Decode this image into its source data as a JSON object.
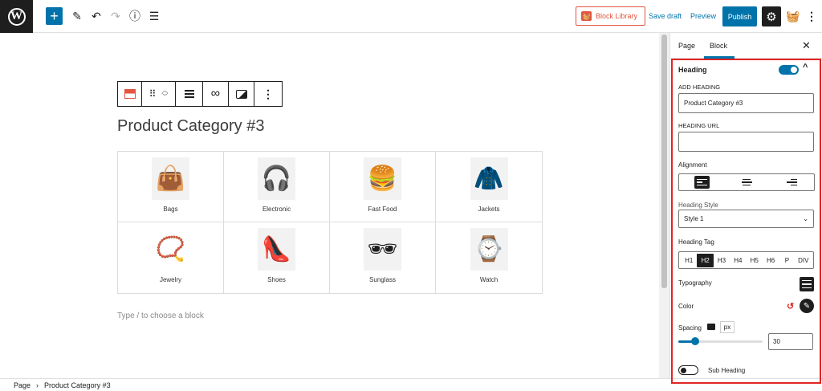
{
  "topbar": {
    "wp_logo": "W",
    "add_icon": "+",
    "block_library_label": "Block Library",
    "save_draft_label": "Save draft",
    "preview_label": "Preview",
    "publish_label": "Publish"
  },
  "editor": {
    "heading": "Product Category #3",
    "placeholder": "Type / to choose a block",
    "categories": [
      {
        "label": "Bags",
        "icon": "bag-icon",
        "glyph": "👜"
      },
      {
        "label": "Electronic",
        "icon": "headphones-icon",
        "glyph": "🎧"
      },
      {
        "label": "Fast Food",
        "icon": "burger-icon",
        "glyph": "🍔"
      },
      {
        "label": "Jackets",
        "icon": "jacket-icon",
        "glyph": "🧥"
      },
      {
        "label": "Jewelry",
        "icon": "necklace-icon",
        "glyph": "📿"
      },
      {
        "label": "Shoes",
        "icon": "high-heel-icon",
        "glyph": "👠"
      },
      {
        "label": "Sunglass",
        "icon": "sunglasses-icon",
        "glyph": "🕶"
      },
      {
        "label": "Watch",
        "icon": "watch-icon",
        "glyph": "⌚"
      }
    ]
  },
  "footer": {
    "crumb_page": "Page",
    "crumb_current": "Product Category #3"
  },
  "sidebar": {
    "tab_page": "Page",
    "tab_block": "Block",
    "close": "✕",
    "panel_title": "Heading",
    "add_heading_label": "ADD HEADING",
    "add_heading_value": "Product Category #3",
    "heading_url_label": "HEADING URL",
    "heading_url_value": "",
    "alignment_label": "Alignment",
    "heading_style_label": "Heading Style",
    "heading_style_value": "Style 1",
    "heading_tag_label": "Heading Tag",
    "tags": [
      "H1",
      "H2",
      "H3",
      "H4",
      "H5",
      "H6",
      "P",
      "DIV"
    ],
    "selected_tag": "H2",
    "typography_label": "Typography",
    "color_label": "Color",
    "spacing_label": "Spacing",
    "spacing_unit": "px",
    "spacing_value": "30",
    "spacing_slider_fraction": 0.2,
    "sub_heading_label": "Sub Heading",
    "sub_heading_enabled": false,
    "heading_enabled": true
  },
  "colors": {
    "accent": "#0073aa",
    "brand": "#e2553f",
    "highlight": "#e02424"
  }
}
